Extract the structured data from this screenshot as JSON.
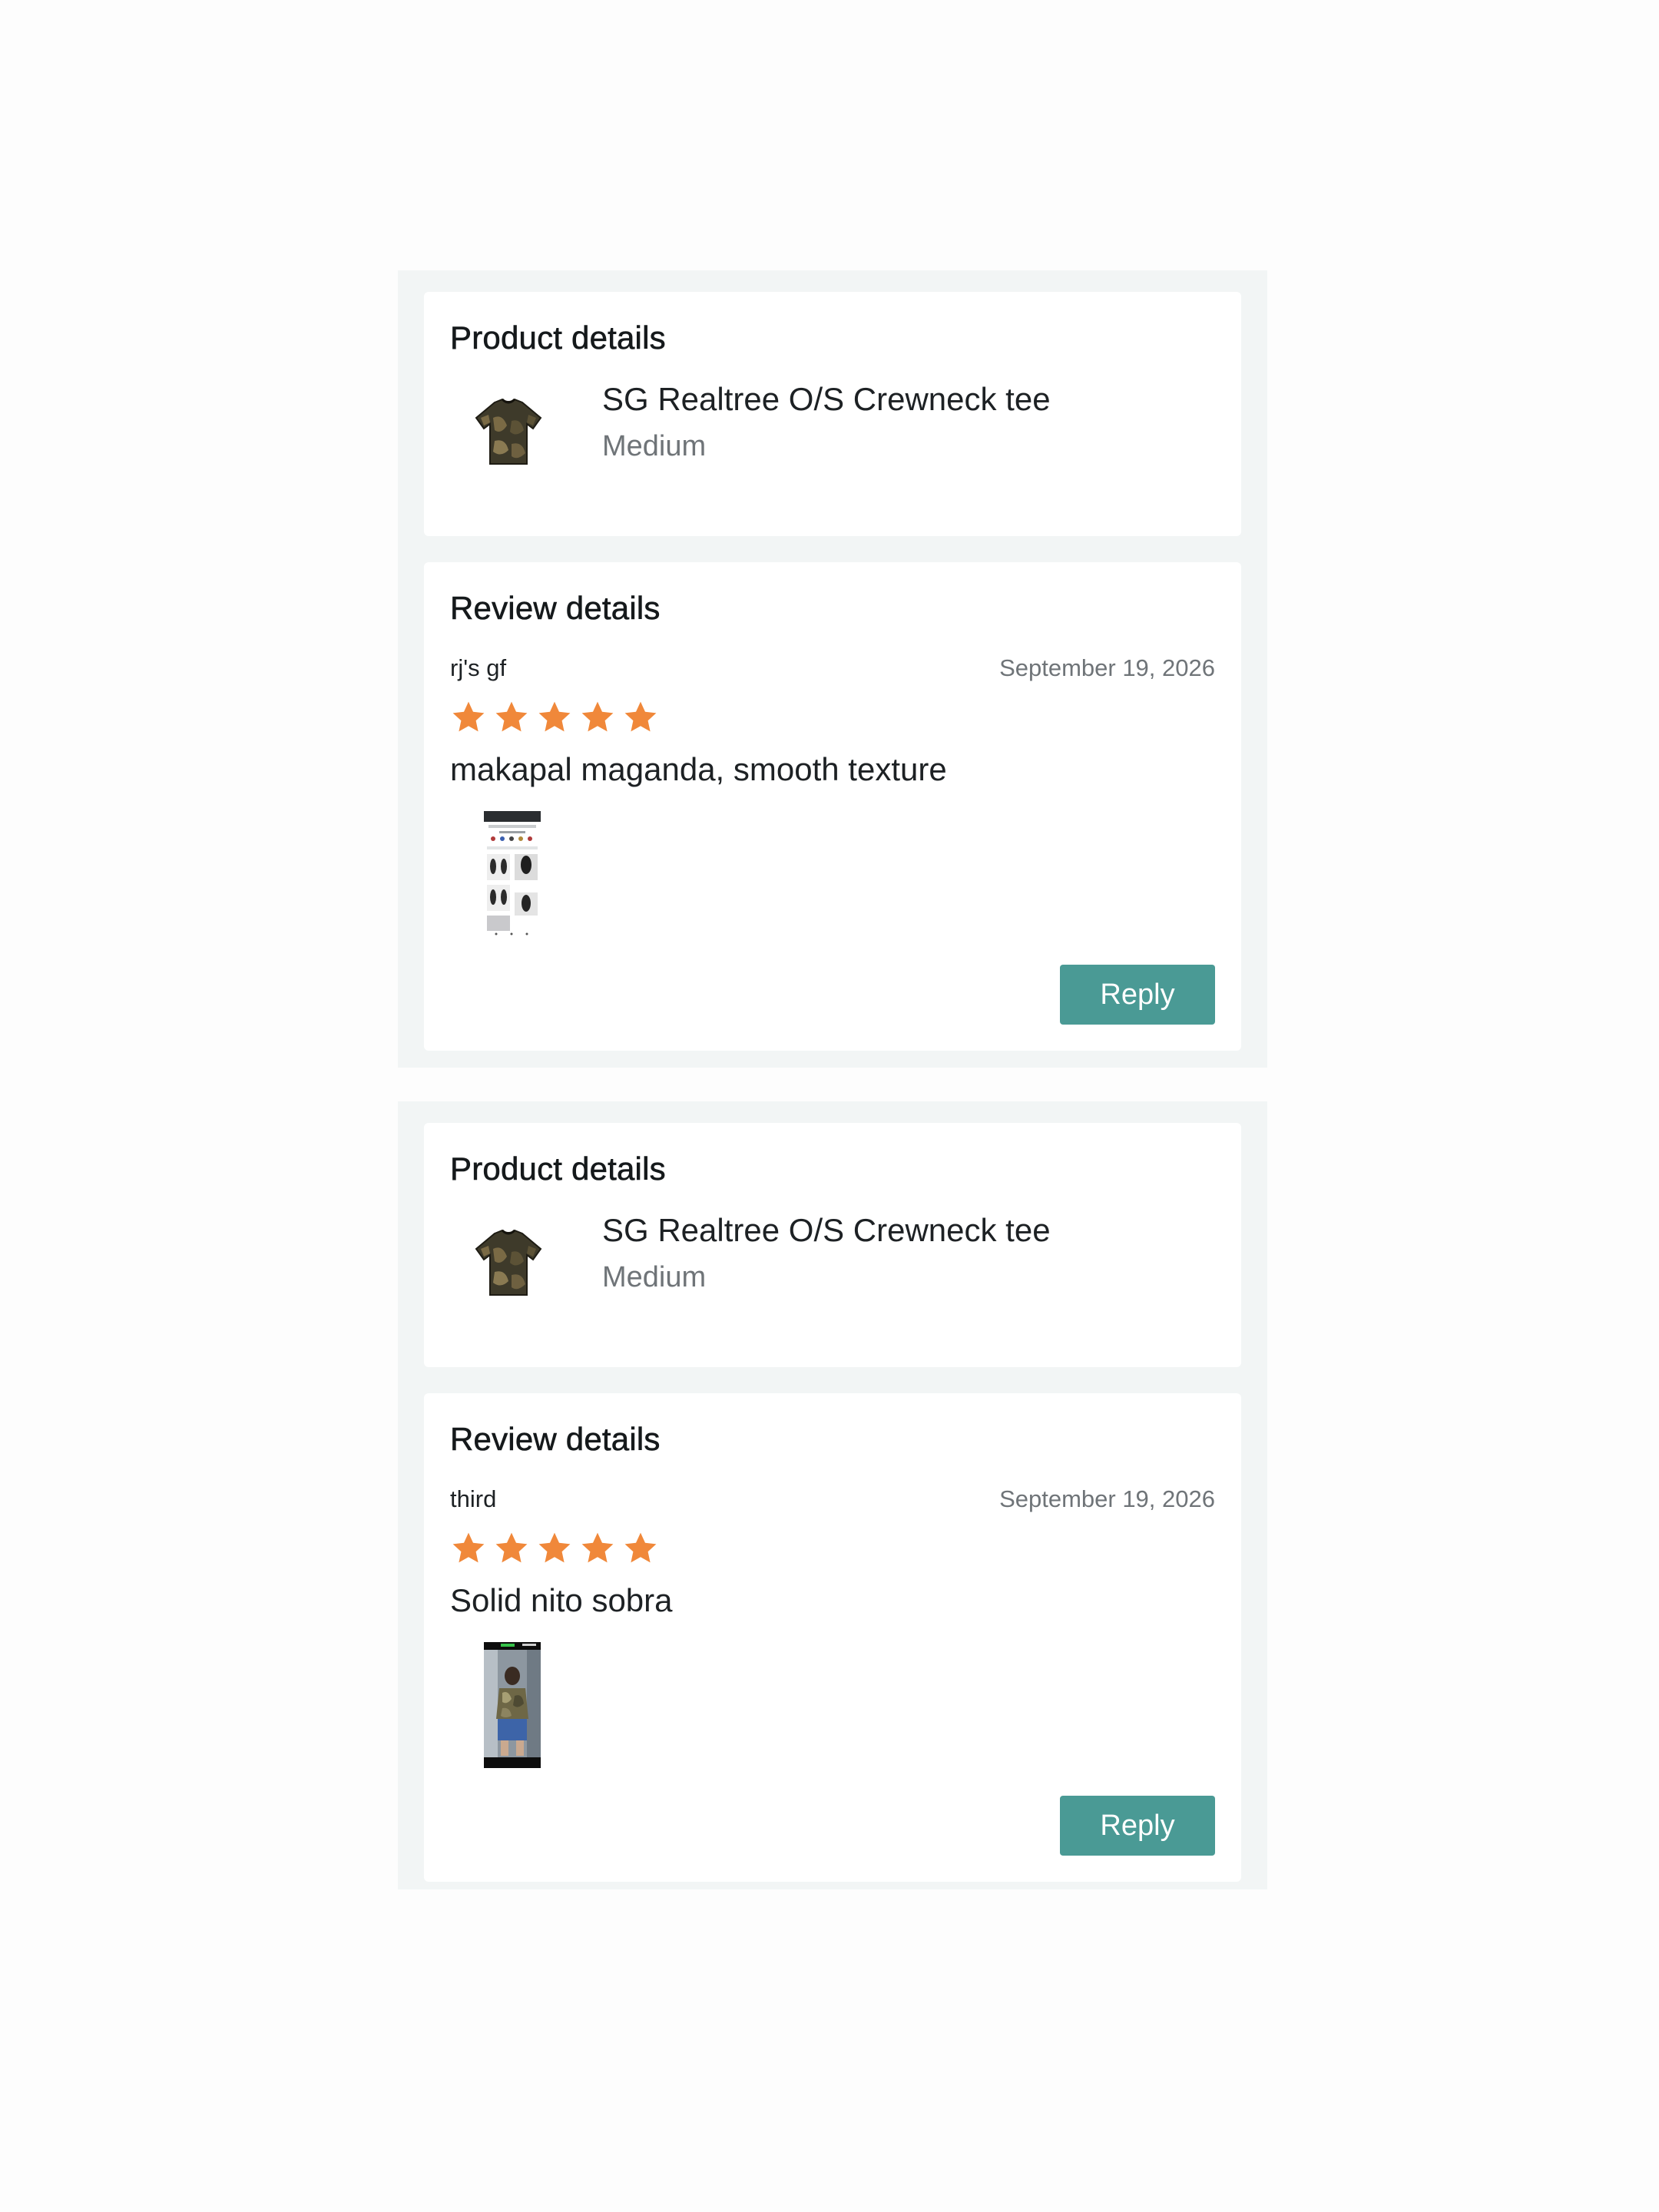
{
  "reviews": [
    {
      "product": {
        "heading": "Product details",
        "name": "SG Realtree O/S Crewneck tee",
        "variant": "Medium",
        "thumbnail_icon": "camo-tshirt"
      },
      "review": {
        "heading": "Review details",
        "reviewer": "rj's gf",
        "date": "September 19, 2026",
        "rating": 5,
        "rating_max": 5,
        "text": "makapal maganda, smooth texture",
        "photo": "screenshot-thumbnail",
        "reply_label": "Reply"
      }
    },
    {
      "product": {
        "heading": "Product details",
        "name": "SG Realtree O/S Crewneck tee",
        "variant": "Medium",
        "thumbnail_icon": "camo-tshirt"
      },
      "review": {
        "heading": "Review details",
        "reviewer": "third",
        "date": "September 19, 2026",
        "rating": 5,
        "rating_max": 5,
        "text": "Solid nito sobra",
        "photo": "mirror-selfie-thumbnail",
        "reply_label": "Reply"
      }
    }
  ],
  "colors": {
    "accent": "#4a9a95",
    "star": "#f0883a",
    "block_background": "#f2f5f5",
    "card_background": "#ffffff"
  }
}
